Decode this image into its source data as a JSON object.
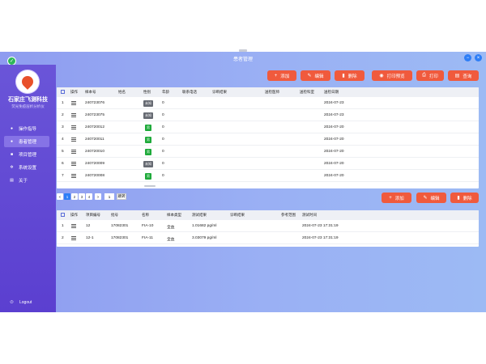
{
  "window": {
    "title": "患者管理",
    "minimize": "−",
    "close": "×"
  },
  "sidebar": {
    "brand_name": "石家庄飞测科技",
    "brand_sub": "荧光免疫层析分析仪",
    "items": [
      {
        "label": "操作指导",
        "icon": "user-icon"
      },
      {
        "label": "患者管理",
        "icon": "people-icon"
      },
      {
        "label": "项目管理",
        "icon": "database-icon"
      },
      {
        "label": "系统设置",
        "icon": "gear-icon"
      },
      {
        "label": "关于",
        "icon": "info-icon"
      }
    ],
    "logout": "Logout"
  },
  "toolbar": {
    "add": "添加",
    "edit": "编辑",
    "delete": "删除",
    "print_preview": "打印预览",
    "print": "打印",
    "query": "查询"
  },
  "patients": {
    "headers": [
      "操作",
      "样本号",
      "姓名",
      "性别",
      "年龄",
      "联系电话",
      "诊断结果",
      "送检医师",
      "送检科室",
      "送检日期"
    ],
    "rows": [
      {
        "index": "1",
        "sample": "240723076",
        "name": "",
        "gender": "未知",
        "gender_type": "grey",
        "age": "0",
        "phone": "",
        "diag": "",
        "doctor": "",
        "dept": "",
        "date": "2024-07-23"
      },
      {
        "index": "2",
        "sample": "240723075",
        "name": "",
        "gender": "未知",
        "gender_type": "grey",
        "age": "0",
        "phone": "",
        "diag": "",
        "doctor": "",
        "dept": "",
        "date": "2024-07-23"
      },
      {
        "index": "3",
        "sample": "240720012",
        "name": "",
        "gender": "男",
        "gender_type": "green",
        "age": "0",
        "phone": "",
        "diag": "",
        "doctor": "",
        "dept": "",
        "date": "2024-07-20"
      },
      {
        "index": "4",
        "sample": "240720011",
        "name": "",
        "gender": "男",
        "gender_type": "green",
        "age": "0",
        "phone": "",
        "diag": "",
        "doctor": "",
        "dept": "",
        "date": "2024-07-20"
      },
      {
        "index": "5",
        "sample": "240720010",
        "name": "",
        "gender": "男",
        "gender_type": "green",
        "age": "0",
        "phone": "",
        "diag": "",
        "doctor": "",
        "dept": "",
        "date": "2024-07-20"
      },
      {
        "index": "6",
        "sample": "240720009",
        "name": "",
        "gender": "未知",
        "gender_type": "grey",
        "age": "0",
        "phone": "",
        "diag": "",
        "doctor": "",
        "dept": "",
        "date": "2024-07-20"
      },
      {
        "index": "7",
        "sample": "240720008",
        "name": "",
        "gender": "男",
        "gender_type": "green",
        "age": "0",
        "phone": "",
        "diag": "",
        "doctor": "",
        "dept": "",
        "date": "2024-07-20"
      }
    ]
  },
  "pager": {
    "prev": "<",
    "pages": [
      "1",
      "2",
      "3",
      "4"
    ],
    "next": ">",
    "jump_value": "1",
    "go": "跳转"
  },
  "results": {
    "headers": [
      "操作",
      "项目编号",
      "批号",
      "名称",
      "样本类型",
      "测试结果",
      "诊断结果",
      "参考范围",
      "测试时间"
    ],
    "rows": [
      {
        "index": "1",
        "code": "12",
        "batch": "17082301",
        "name": "FIA-10",
        "type": "全血",
        "result": "1.01682 pg/ml",
        "diag": "",
        "range": "",
        "time": "2024-07-23 17:31:19"
      },
      {
        "index": "2",
        "code": "12-1",
        "batch": "17082301",
        "name": "FIA-11",
        "type": "全血",
        "result": "3.03079 pg/ml",
        "diag": "",
        "range": "",
        "time": "2024-07-23 17:31:19"
      }
    ]
  },
  "colors": {
    "accent": "#f05a3d",
    "sidebar": "#5b3fd0",
    "primary": "#2d7ef7",
    "tag_green": "#1eaa3a",
    "tag_grey": "#666a72"
  }
}
